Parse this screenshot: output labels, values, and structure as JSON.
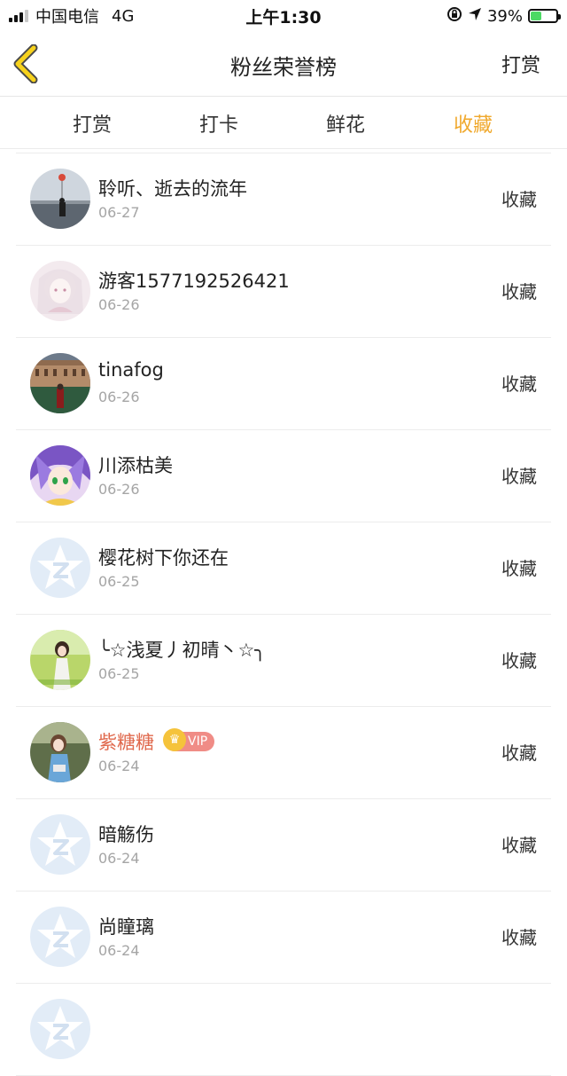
{
  "status_bar": {
    "carrier": "中国电信",
    "network": "4G",
    "time": "上午1:30",
    "battery": "39%"
  },
  "nav": {
    "title": "粉丝荣誉榜",
    "right_label": "打赏"
  },
  "tabs": [
    {
      "label": "打赏",
      "active": false
    },
    {
      "label": "打卡",
      "active": false
    },
    {
      "label": "鲜花",
      "active": false
    },
    {
      "label": "收藏",
      "active": true
    }
  ],
  "colors": {
    "accent": "#f0a92e",
    "vip_name": "#e06a4e",
    "vip_badge": "#f08c86",
    "crown": "#f5c33b"
  },
  "list": [
    {
      "name": "聆听、逝去的流年",
      "date": "06-27",
      "action": "收藏",
      "avatar": "photo-sea-balloon"
    },
    {
      "name": "游客1577192526421",
      "date": "06-26",
      "action": "收藏",
      "avatar": "anime-girl-pink"
    },
    {
      "name": "tinafog",
      "date": "06-26",
      "action": "收藏",
      "avatar": "photo-building"
    },
    {
      "name": "川添枯美",
      "date": "06-26",
      "action": "收藏",
      "avatar": "anime-purple-hair"
    },
    {
      "name": "樱花树下你还在",
      "date": "06-25",
      "action": "收藏",
      "avatar": "default-avatar"
    },
    {
      "name": "╰☆浅夏丿初晴丶☆╮",
      "date": "06-25",
      "action": "收藏",
      "avatar": "photo-girl-grass"
    },
    {
      "name": "紫糖糖",
      "date": "06-24",
      "action": "收藏",
      "avatar": "photo-girl-park",
      "vip": "VIP"
    },
    {
      "name": "暗觞伤",
      "date": "06-24",
      "action": "收藏",
      "avatar": "default-avatar"
    },
    {
      "name": "尚瞳璃",
      "date": "06-24",
      "action": "收藏",
      "avatar": "default-avatar"
    },
    {
      "name": "",
      "date": "",
      "action": "",
      "avatar": "default-avatar"
    }
  ]
}
